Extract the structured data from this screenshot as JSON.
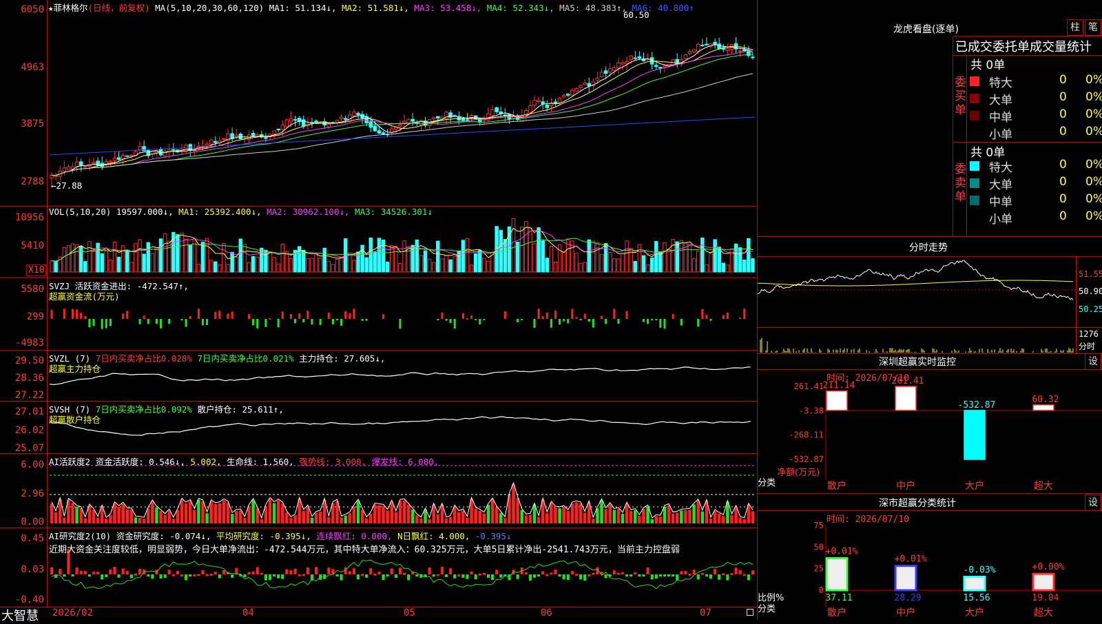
{
  "stock": {
    "name": "菲林格尔",
    "star": "★",
    "period": "(日线，前复权)",
    "ma_params": "MA(5,10,20,30,60,120)",
    "ma": [
      {
        "label": "MA1: 51.134↓,",
        "color": "#ffffff"
      },
      {
        "label": "MA2: 51.581↓,",
        "color": "#ffff3b"
      },
      {
        "label": "MA3: 53.458↓,",
        "color": "#ff3bff"
      },
      {
        "label": "MA4: 52.343↓,",
        "color": "#3bff3b"
      },
      {
        "label": "MA5: 48.383↑,",
        "color": "#cfcfcf"
      },
      {
        "label": "MA6: 40.800↑",
        "color": "#3b5bff"
      }
    ],
    "high_marker": "60.50",
    "low_marker": "←27.88"
  },
  "price_axis": [
    "6050",
    "4963",
    "3875",
    "2788"
  ],
  "vol": {
    "label": "VOL(5,10,20)",
    "value": "19597.000↓,",
    "ma1": "MA1: 25392.400↓,",
    "ma2": "MA2: 30962.100↓,",
    "ma3": "MA3: 34526.301↓",
    "axis": [
      "10956",
      "5410"
    ],
    "unit": "X10"
  },
  "svzj": {
    "label": "SVZJ",
    "text": "活跃资金进出: -472.547↑,",
    "sub": "超赢资金流(万元)",
    "axis": [
      "5580",
      "299",
      "-4983"
    ]
  },
  "svzl": {
    "label": "SVZL (7)",
    "t1": "7日内买卖净占比0.028%",
    "t2": "7日内买卖净占比0.021%",
    "t3": "主力持仓: 27.605↓,",
    "sub": "超赢主力持仓",
    "axis": [
      "29.50",
      "28.36",
      "27.22"
    ]
  },
  "svsh": {
    "label": "SVSH (7)",
    "t1": "7日内买卖净占比0.092%",
    "t2": "散户持仓: 25.611↑,",
    "sub": "超赢散户持仓",
    "axis": [
      "27.01",
      "26.02",
      "25.07"
    ]
  },
  "ai1": {
    "label": "AI活跃度2",
    "t1": "资金活跃度: 0.546↓,",
    "t2": "5.002,",
    "t3": "生命线: 1.560,",
    "t4": "强势线: 3.000,",
    "t5": "爆发线: 6.000,",
    "axis": [
      "6.00",
      "2.96",
      "0.00"
    ]
  },
  "ai2": {
    "label": "AI研究度2(10)",
    "t1": "资金研究度: -0.074↓,",
    "t2": "平均研究度: -0.395↓,",
    "t3": "连续飘红: 0.000,",
    "t4": "N日飘红: 4.000,",
    "t5": "-0.395↓",
    "note": "近期大资金关注度较低，明显弱势，今日大单净流出：-472.544万元，其中特大单净流入：60.325万元，大单5日累计净出-2541.743万元，当前主力控盘弱",
    "axis": [
      "0.45",
      "0.03",
      "-0.40"
    ]
  },
  "footer": {
    "brand": "大智慧",
    "dates": [
      "2026/02",
      "04",
      "05",
      "06",
      "07"
    ]
  },
  "longhu": {
    "title": "龙虎看盘(逐单)",
    "btn1": "柱",
    "btn2": "笔",
    "tab": "已成交委托单成交量统计",
    "buy_label": "委买单",
    "sell_label": "委卖单",
    "buy_total": "共 0单",
    "sell_total": "共 0单",
    "buy_rows": [
      {
        "name": "特大",
        "v": "0",
        "p": "0%",
        "color": "#ff2020"
      },
      {
        "name": "大单",
        "v": "0",
        "p": "0%",
        "color": "#8b0000"
      },
      {
        "name": "中单",
        "v": "0",
        "p": "0%",
        "color": "#6a0000"
      },
      {
        "name": "小单",
        "v": "0",
        "p": "0%",
        "color": "#000000"
      }
    ],
    "sell_rows": [
      {
        "name": "特大",
        "v": "0",
        "p": "0%",
        "color": "#00ffff"
      },
      {
        "name": "大单",
        "v": "0",
        "p": "0%",
        "color": "#008b8b"
      },
      {
        "name": "中单",
        "v": "0",
        "p": "0%",
        "color": "#006b6b"
      },
      {
        "name": "小单",
        "v": "0",
        "p": "0%",
        "color": "#000000"
      }
    ]
  },
  "fenshi": {
    "title": "分时走势",
    "axis": [
      "51.55",
      "50.90",
      "50.25"
    ],
    "vol_axis": "1276",
    "vol_label": "分时"
  },
  "sz_monitor": {
    "title": "深圳超赢实时监控",
    "btn": "设",
    "time": "时间: 2026/07/10",
    "axis": [
      "261.41",
      "-3.38",
      "-268.11",
      "-532.87"
    ],
    "y_unit": "净额(万元)",
    "x_unit": "分类",
    "categories": [
      "散户",
      "中户",
      "大户",
      "超大"
    ],
    "values": [
      "211.14",
      "261.41",
      "-532.87",
      "60.32"
    ],
    "nums": [
      211.14,
      261.41,
      -532.87,
      60.32
    ]
  },
  "sz_stat": {
    "title": "深市超赢分类统计",
    "btn": "设",
    "time": "时间: 2026/07/10",
    "axis": [
      "75",
      "50",
      "25",
      "0"
    ],
    "y_unit": "比例%",
    "x_unit": "分类",
    "categories": [
      "散户",
      "中户",
      "大户",
      "超大"
    ],
    "pct_change": [
      "+0.01%",
      "+0.01%",
      "-0.03%",
      "+0.00%"
    ],
    "values": [
      "37.11",
      "28.29",
      "15.56",
      "19.04"
    ],
    "nums": [
      37.11,
      28.29,
      15.56,
      19.04
    ]
  }
}
